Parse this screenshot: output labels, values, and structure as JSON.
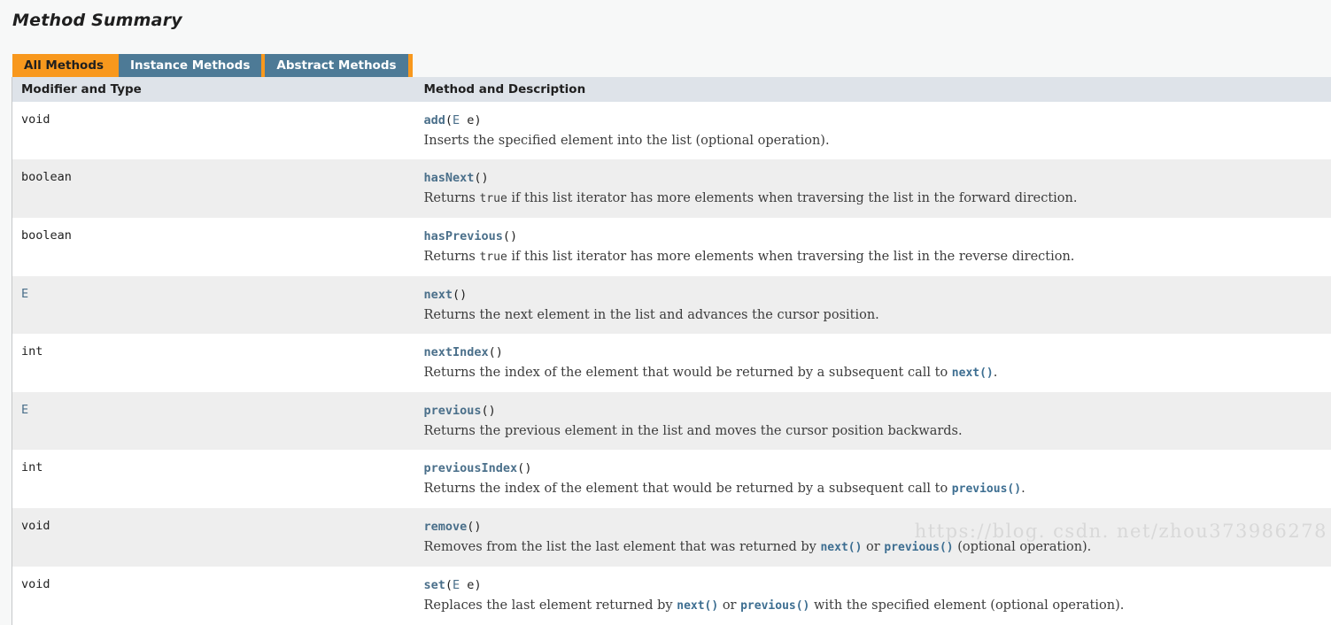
{
  "page": {
    "title": "Method Summary",
    "watermark": "https://blog. csdn. net/zhou373986278",
    "colors": {
      "background": "#f7f8f8",
      "tab_active": "#f8981d",
      "tab_inactive": "#4d7a96",
      "header_bg": "#dee3e9",
      "row_alt_bg": "#eeeeee",
      "row_bg": "#ffffff",
      "link": "#4a6f8a"
    }
  },
  "tabs": [
    {
      "label": "All Methods",
      "active": true
    },
    {
      "label": "Instance Methods",
      "active": false
    },
    {
      "label": "Abstract Methods",
      "active": false
    }
  ],
  "table": {
    "headers": {
      "modifier_and_type": "Modifier and Type",
      "method_and_description": "Method and Description"
    },
    "rows": [
      {
        "type": "void",
        "type_is_link": false,
        "method_name": "add",
        "params_open": "(",
        "param_type": "E",
        "param_name": " e",
        "params_close": ")",
        "description_parts": [
          {
            "kind": "text",
            "text": "Inserts the specified element into the list (optional operation)."
          }
        ]
      },
      {
        "type": "boolean",
        "type_is_link": false,
        "method_name": "hasNext",
        "params_open": "(",
        "param_type": "",
        "param_name": "",
        "params_close": ")",
        "description_parts": [
          {
            "kind": "text",
            "text": "Returns "
          },
          {
            "kind": "code",
            "text": "true"
          },
          {
            "kind": "text",
            "text": " if this list iterator has more elements when traversing the list in the forward direction."
          }
        ]
      },
      {
        "type": "boolean",
        "type_is_link": false,
        "method_name": "hasPrevious",
        "params_open": "(",
        "param_type": "",
        "param_name": "",
        "params_close": ")",
        "description_parts": [
          {
            "kind": "text",
            "text": "Returns "
          },
          {
            "kind": "code",
            "text": "true"
          },
          {
            "kind": "text",
            "text": " if this list iterator has more elements when traversing the list in the reverse direction."
          }
        ]
      },
      {
        "type": "E",
        "type_is_link": true,
        "method_name": "next",
        "params_open": "(",
        "param_type": "",
        "param_name": "",
        "params_close": ")",
        "description_parts": [
          {
            "kind": "text",
            "text": "Returns the next element in the list and advances the cursor position."
          }
        ]
      },
      {
        "type": "int",
        "type_is_link": false,
        "method_name": "nextIndex",
        "params_open": "(",
        "param_type": "",
        "param_name": "",
        "params_close": ")",
        "description_parts": [
          {
            "kind": "text",
            "text": "Returns the index of the element that would be returned by a subsequent call to "
          },
          {
            "kind": "codelink",
            "text": "next()"
          },
          {
            "kind": "text",
            "text": "."
          }
        ]
      },
      {
        "type": "E",
        "type_is_link": true,
        "method_name": "previous",
        "params_open": "(",
        "param_type": "",
        "param_name": "",
        "params_close": ")",
        "description_parts": [
          {
            "kind": "text",
            "text": "Returns the previous element in the list and moves the cursor position backwards."
          }
        ]
      },
      {
        "type": "int",
        "type_is_link": false,
        "method_name": "previousIndex",
        "params_open": "(",
        "param_type": "",
        "param_name": "",
        "params_close": ")",
        "description_parts": [
          {
            "kind": "text",
            "text": "Returns the index of the element that would be returned by a subsequent call to "
          },
          {
            "kind": "codelink",
            "text": "previous()"
          },
          {
            "kind": "text",
            "text": "."
          }
        ]
      },
      {
        "type": "void",
        "type_is_link": false,
        "method_name": "remove",
        "params_open": "(",
        "param_type": "",
        "param_name": "",
        "params_close": ")",
        "description_parts": [
          {
            "kind": "text",
            "text": "Removes from the list the last element that was returned by "
          },
          {
            "kind": "codelink",
            "text": "next()"
          },
          {
            "kind": "text",
            "text": " or "
          },
          {
            "kind": "codelink",
            "text": "previous()"
          },
          {
            "kind": "text",
            "text": " (optional operation)."
          }
        ]
      },
      {
        "type": "void",
        "type_is_link": false,
        "method_name": "set",
        "params_open": "(",
        "param_type": "E",
        "param_name": " e",
        "params_close": ")",
        "description_parts": [
          {
            "kind": "text",
            "text": "Replaces the last element returned by "
          },
          {
            "kind": "codelink",
            "text": "next()"
          },
          {
            "kind": "text",
            "text": " or "
          },
          {
            "kind": "codelink",
            "text": "previous()"
          },
          {
            "kind": "text",
            "text": " with the specified element (optional operation)."
          }
        ]
      }
    ]
  }
}
